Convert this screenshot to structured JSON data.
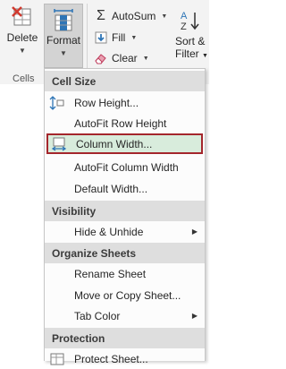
{
  "ribbon": {
    "delete_label": "Delete",
    "format_label": "Format",
    "cells_group": "Cells",
    "autosum_label": "AutoSum",
    "fill_label": "Fill",
    "clear_label": "Clear",
    "sort_label": "Sort &",
    "filter_label": "Filter"
  },
  "menu": {
    "cell_size": {
      "header": "Cell Size",
      "row_height": "Row Height...",
      "autofit_row": "AutoFit Row Height",
      "column_width": "Column Width...",
      "autofit_column": "AutoFit Column Width",
      "default_width": "Default Width..."
    },
    "visibility": {
      "header": "Visibility",
      "hide_unhide": "Hide & Unhide"
    },
    "organize": {
      "header": "Organize Sheets",
      "rename": "Rename Sheet",
      "move_copy": "Move or Copy Sheet...",
      "tab_color": "Tab Color"
    },
    "protection": {
      "header": "Protection",
      "protect_sheet": "Protect Sheet..."
    }
  },
  "colors": {
    "highlight_fill": "#d8ecdc",
    "highlight_border": "#a4262c",
    "header_bg": "#dedede",
    "format_button_bg": "#d3d3d3"
  }
}
